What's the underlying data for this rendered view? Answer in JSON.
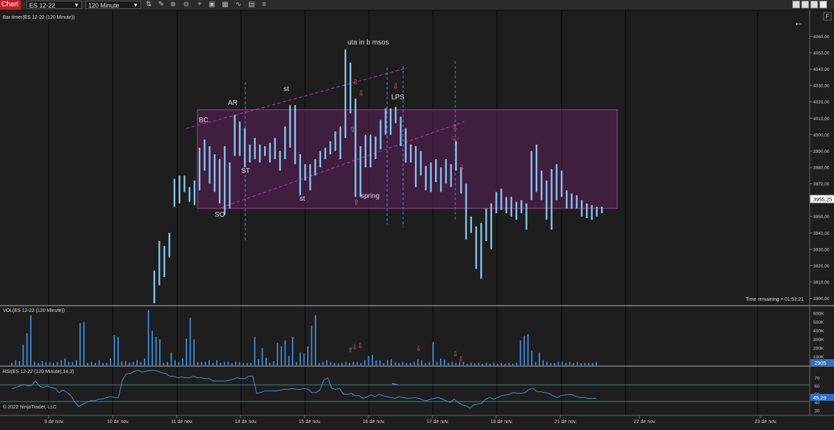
{
  "toolbar": {
    "title": "Chart",
    "instrument": "ES 12-22",
    "interval": "120 Minute",
    "icons": [
      "bar-type-icon",
      "pencil-icon",
      "zoom-in-icon",
      "zoom-out-icon",
      "crosshair-icon",
      "data-box-icon",
      "strategy-icon",
      "indicator-icon",
      "properties-icon",
      "list-icon"
    ]
  },
  "window": {
    "buttons": [
      "minimize-button",
      "maximize-button",
      "restore-button",
      "close-button"
    ],
    "f_label": "F"
  },
  "price_panel": {
    "title": "Bar timer(ES 12-22 (120 Minute))",
    "y_ticks": [
      "4060,00",
      "4050,00",
      "4040,00",
      "4030,00",
      "4020,00",
      "4010,00",
      "4000,00",
      "3990,00",
      "3980,00",
      "3970,00",
      "3960,00",
      "3950,00",
      "3940,00",
      "3930,00",
      "3920,00",
      "3910,00",
      "3900,00"
    ],
    "current_price": "3955,25",
    "time_remaining": "Time remaining = 01:53:21",
    "annotations": [
      "uta in b msos",
      "st",
      "AR",
      "BC",
      "LPS",
      "ST",
      "SO",
      "st",
      "spring",
      "SU"
    ]
  },
  "volume_panel": {
    "title": "VOL(ES 12-22 (120 Minute))",
    "y_ticks": [
      "600K",
      "500K",
      "400K",
      "300K",
      "200K",
      "100K"
    ],
    "current_value": "2905"
  },
  "rsi_panel": {
    "title": "RSI(ES 12-22 (120 Minute),14,3)",
    "y_ticks": [
      "70",
      "60",
      "50",
      "40",
      "30"
    ],
    "current_value": "45,29"
  },
  "x_axis": {
    "labels": [
      "9 de nov.",
      "10 de nov.",
      "11 de nov.",
      "14 de nov.",
      "15 de nov.",
      "16 de nov.",
      "17 de nov.",
      "18 de nov.",
      "21 de nov.",
      "22 de nov.",
      "23 de nov."
    ]
  },
  "copyright": "© 2022 NinjaTrader, LLC",
  "colors": {
    "background": "#1e1e1e",
    "bars": "#87c8f0",
    "range_box": "#6a1f6a",
    "channel": "#c030c0",
    "volume": "#3f8fe0",
    "rsi": "#3f8fe0",
    "title_red": "#c0202a"
  },
  "chart_data": {
    "type": "bar",
    "title": "ES 12-22 (120 Minute)",
    "price": {
      "bars": [
        {
          "lo": 3897,
          "hi": 3917
        },
        {
          "lo": 3908,
          "hi": 3935
        },
        {
          "lo": 3913,
          "hi": 3932
        },
        {
          "lo": 3925,
          "hi": 3940
        },
        {
          "lo": 3956,
          "hi": 3973
        },
        {
          "lo": 3958,
          "hi": 3975
        },
        {
          "lo": 3965,
          "hi": 3975
        },
        {
          "lo": 3959,
          "hi": 3968
        },
        {
          "lo": 3957,
          "hi": 3972
        },
        {
          "lo": 3966,
          "hi": 3992
        },
        {
          "lo": 3978,
          "hi": 3997
        },
        {
          "lo": 3970,
          "hi": 3993
        },
        {
          "lo": 3965,
          "hi": 3988
        },
        {
          "lo": 3958,
          "hi": 3985
        },
        {
          "lo": 3951,
          "hi": 3993
        },
        {
          "lo": 3955,
          "hi": 3983
        },
        {
          "lo": 3987,
          "hi": 4012
        },
        {
          "lo": 3987,
          "hi": 4008
        },
        {
          "lo": 3980,
          "hi": 4004
        },
        {
          "lo": 3983,
          "hi": 3994
        },
        {
          "lo": 3985,
          "hi": 3998
        },
        {
          "lo": 3983,
          "hi": 3994
        },
        {
          "lo": 3987,
          "hi": 3993
        },
        {
          "lo": 3983,
          "hi": 3995
        },
        {
          "lo": 3985,
          "hi": 3998
        },
        {
          "lo": 3978,
          "hi": 3990
        },
        {
          "lo": 3985,
          "hi": 4005
        },
        {
          "lo": 3992,
          "hi": 4018
        },
        {
          "lo": 3982,
          "hi": 4018
        },
        {
          "lo": 3963,
          "hi": 3988
        },
        {
          "lo": 3972,
          "hi": 3982
        },
        {
          "lo": 3966,
          "hi": 3982
        },
        {
          "lo": 3975,
          "hi": 3985
        },
        {
          "lo": 3980,
          "hi": 3990
        },
        {
          "lo": 3985,
          "hi": 3992
        },
        {
          "lo": 3988,
          "hi": 3996
        },
        {
          "lo": 3990,
          "hi": 4002
        },
        {
          "lo": 3985,
          "hi": 4005
        },
        {
          "lo": 3998,
          "hi": 4052
        },
        {
          "lo": 4013,
          "hi": 4044
        },
        {
          "lo": 3962,
          "hi": 4022
        },
        {
          "lo": 3962,
          "hi": 3993
        },
        {
          "lo": 3980,
          "hi": 4000
        },
        {
          "lo": 3980,
          "hi": 4000
        },
        {
          "lo": 3985,
          "hi": 3999
        },
        {
          "lo": 3991,
          "hi": 4009
        },
        {
          "lo": 4000,
          "hi": 4016
        },
        {
          "lo": 4000,
          "hi": 4016
        },
        {
          "lo": 4007,
          "hi": 4017
        },
        {
          "lo": 3993,
          "hi": 4011
        },
        {
          "lo": 3983,
          "hi": 4004
        },
        {
          "lo": 3983,
          "hi": 3994
        },
        {
          "lo": 3968,
          "hi": 3993
        },
        {
          "lo": 3975,
          "hi": 3990
        },
        {
          "lo": 3966,
          "hi": 3981
        },
        {
          "lo": 3965,
          "hi": 3983
        },
        {
          "lo": 3971,
          "hi": 3985
        },
        {
          "lo": 3965,
          "hi": 3980
        },
        {
          "lo": 3970,
          "hi": 3985
        },
        {
          "lo": 3968,
          "hi": 3982
        },
        {
          "lo": 3978,
          "hi": 3996
        },
        {
          "lo": 3964,
          "hi": 3980
        },
        {
          "lo": 3936,
          "hi": 3970
        },
        {
          "lo": 3940,
          "hi": 3950
        },
        {
          "lo": 3918,
          "hi": 3944
        },
        {
          "lo": 3912,
          "hi": 3946
        },
        {
          "lo": 3935,
          "hi": 3955
        },
        {
          "lo": 3930,
          "hi": 3958
        },
        {
          "lo": 3952,
          "hi": 3965
        },
        {
          "lo": 3954,
          "hi": 3967
        },
        {
          "lo": 3952,
          "hi": 3962
        },
        {
          "lo": 3950,
          "hi": 3962
        },
        {
          "lo": 3948,
          "hi": 3959
        },
        {
          "lo": 3952,
          "hi": 3960
        },
        {
          "lo": 3942,
          "hi": 3958
        },
        {
          "lo": 3960,
          "hi": 3990
        },
        {
          "lo": 3965,
          "hi": 3994
        },
        {
          "lo": 3960,
          "hi": 3978
        },
        {
          "lo": 3948,
          "hi": 3972
        },
        {
          "lo": 3942,
          "hi": 3979
        },
        {
          "lo": 3960,
          "hi": 3982
        },
        {
          "lo": 3962,
          "hi": 3978
        },
        {
          "lo": 3955,
          "hi": 3966
        },
        {
          "lo": 3955,
          "hi": 3964
        },
        {
          "lo": 3955,
          "hi": 3963
        },
        {
          "lo": 3950,
          "hi": 3960
        },
        {
          "lo": 3949,
          "hi": 3958
        },
        {
          "lo": 3948,
          "hi": 3957
        },
        {
          "lo": 3950,
          "hi": 3956
        },
        {
          "lo": 3952,
          "hi": 3956
        }
      ],
      "ylim": [
        3896,
        4064
      ]
    },
    "volume_k": [
      30,
      60,
      50,
      240,
      370,
      580,
      40,
      30,
      50,
      40,
      35,
      30,
      40,
      60,
      80,
      40,
      40,
      60,
      490,
      500,
      30,
      40,
      30,
      60,
      30,
      30,
      80,
      350,
      330,
      45,
      50,
      35,
      40,
      60,
      40,
      80,
      640,
      400,
      330,
      300,
      30,
      40,
      150,
      60,
      40,
      80,
      310,
      550,
      300,
      40,
      40,
      40,
      60,
      30,
      60,
      30,
      40,
      40,
      30,
      40,
      35,
      30,
      30,
      30,
      330,
      70,
      200,
      90,
      30,
      50,
      260,
      220,
      290,
      110,
      330,
      40,
      150,
      140,
      220,
      460,
      580,
      30,
      40,
      60,
      35,
      30,
      25,
      30,
      40,
      30,
      40,
      40,
      30,
      60,
      110,
      120,
      60,
      60,
      30,
      60,
      70,
      35,
      30,
      40,
      30,
      30,
      40,
      70,
      60,
      30,
      35,
      270,
      40,
      80,
      70,
      30,
      40,
      30,
      40,
      40,
      20,
      30,
      25,
      30,
      20,
      30,
      20,
      30,
      20,
      30,
      20,
      30,
      20,
      30,
      290,
      340,
      360,
      170,
      40,
      150,
      60,
      40,
      30,
      30,
      40,
      40,
      30,
      40,
      30,
      40,
      25,
      30,
      30,
      30,
      35
    ],
    "volume_ylim": [
      0,
      650
    ],
    "rsi": [
      57,
      58,
      60,
      62,
      60,
      61,
      66,
      60,
      58,
      60,
      58,
      57,
      52,
      55,
      52,
      48,
      40,
      35,
      38,
      40,
      42,
      42,
      44,
      44,
      46,
      47,
      46,
      46,
      67,
      75,
      75,
      78,
      79,
      77,
      78,
      79,
      79,
      78,
      76,
      75,
      72,
      72,
      70,
      71,
      70,
      70,
      72,
      70,
      70,
      69,
      69,
      66,
      66,
      66,
      66,
      67,
      68,
      70,
      69,
      69,
      72,
      72,
      51,
      52,
      54,
      54,
      54,
      54,
      55,
      56,
      56,
      57,
      56,
      56,
      57,
      56,
      52,
      52,
      55,
      67,
      70,
      57,
      56,
      57,
      50,
      50,
      51,
      48,
      48,
      45,
      47,
      49,
      47,
      50,
      48,
      47,
      46,
      45,
      47,
      46,
      45,
      45,
      46,
      45,
      43,
      42,
      44,
      45,
      46,
      44,
      42,
      40,
      44,
      40,
      37,
      36,
      33,
      37,
      38,
      39,
      44,
      46,
      44,
      46,
      48,
      49,
      50,
      52,
      51,
      51,
      52,
      56,
      57,
      53,
      53,
      52,
      51,
      48,
      46,
      48,
      49,
      50,
      49,
      47,
      46,
      46,
      45,
      45,
      45
    ],
    "rsi_ylim": [
      25,
      80
    ],
    "x_labels": [
      "9 de nov.",
      "10 de nov.",
      "11 de nov.",
      "14 de nov.",
      "15 de nov.",
      "16 de nov.",
      "17 de nov.",
      "18 de nov.",
      "21 de nov.",
      "22 de nov.",
      "23 de nov."
    ]
  }
}
